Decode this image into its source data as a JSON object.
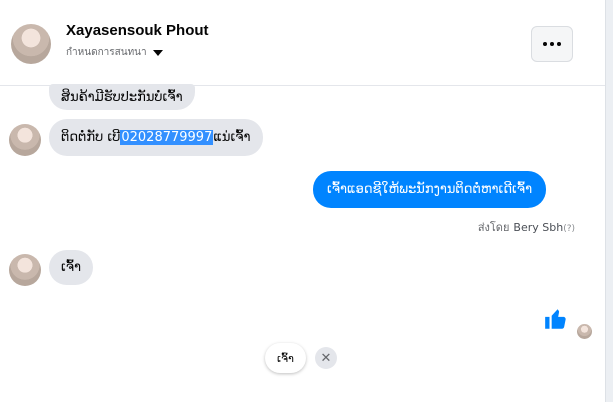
{
  "header": {
    "contact_name": "Xayasensouk Phout",
    "subtitle": "กำหนดการสนทนา"
  },
  "messages": {
    "m1": "ສິນຄ້າມີຮັບປະກັນບໍ່ເຈົ້າ",
    "m2_prefix": "ຕິດຕໍ່ກັບ ເບີ ",
    "m2_phone": "02028779997",
    "m2_suffix": " ແນ່ເຈົ້າ",
    "m3_outgoing": "ເຈົ້າແອດຊີໃຫ້ພະນັກງານຕິດຕໍ່ຫາເດີເຈົ້າ",
    "m4": "ເຈົ້າ"
  },
  "sent_by": {
    "prefix": "ส่งโดย",
    "name": "Bery Sbh",
    "help": "(?)"
  },
  "quick_reply": {
    "label": "ເຈົ້າ"
  },
  "icons": {
    "more": "more-horizontal-icon",
    "like": "thumbs-up-icon",
    "close": "close-icon"
  },
  "colors": {
    "accent": "#0084ff",
    "highlight": "#3390ff",
    "incoming_bubble": "#e4e6eb"
  }
}
